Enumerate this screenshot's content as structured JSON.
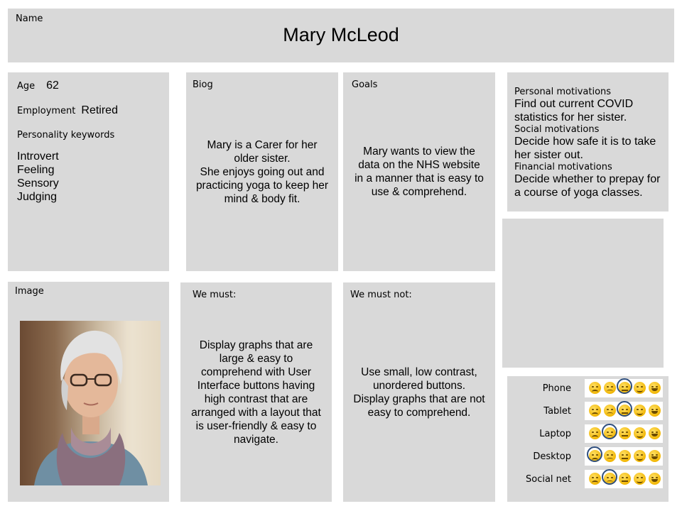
{
  "name": {
    "label": "Name",
    "value": "Mary McLeod"
  },
  "profile": {
    "age_label": "Age",
    "age_value": "62",
    "employment_label": "Employment",
    "employment_value": "Retired",
    "personality_label": "Personality keywords",
    "keywords": [
      "Introvert",
      "Feeling",
      "Sensory",
      "Judging"
    ]
  },
  "biog": {
    "label": "Biog",
    "lines": [
      "Mary is a Carer for her",
      "older sister.",
      "She enjoys going out and",
      "practicing yoga to keep her",
      "mind & body fit."
    ]
  },
  "goals": {
    "label": "Goals",
    "lines": [
      "Mary wants to view the",
      "data on the NHS website",
      "in a manner that is easy to",
      "use & comprehend."
    ]
  },
  "motivations": {
    "personal_label": "Personal motivations",
    "personal_lines": [
      "Find out current COVID",
      "statistics for her sister."
    ],
    "social_label": "Social motivations",
    "social_lines": [
      "Decide how safe it is to take",
      "her sister out."
    ],
    "financial_label": "Financial motivations",
    "financial_lines": [
      "Decide whether to prepay for",
      "a course of yoga classes."
    ]
  },
  "image": {
    "label": "Image",
    "alt": "portrait-photo"
  },
  "we_must": {
    "label": "We must:",
    "lines": [
      "Display graphs that are",
      "large & easy to",
      "comprehend with User",
      "Interface buttons having",
      "high contrast that are",
      "arranged with a layout that",
      "is user-friendly & easy to",
      "navigate."
    ]
  },
  "we_must_not": {
    "label": "We must not:",
    "lines": [
      "Use small, low contrast,",
      "unordered buttons.",
      "Display graphs that are not",
      "easy to comprehend."
    ]
  },
  "devices": {
    "scale_icons": [
      "very-sad-face-icon",
      "sad-face-icon",
      "neutral-face-icon",
      "happy-face-icon",
      "very-happy-face-icon"
    ],
    "rows": [
      {
        "name": "Phone",
        "selected": 2
      },
      {
        "name": "Tablet",
        "selected": 2
      },
      {
        "name": "Laptop",
        "selected": 1
      },
      {
        "name": "Desktop",
        "selected": 0
      },
      {
        "name": "Social net",
        "selected": 1
      }
    ]
  },
  "colors": {
    "panel": "#d9d9d9",
    "ring": "#2f4f7f",
    "emoji": "#f2b705"
  }
}
